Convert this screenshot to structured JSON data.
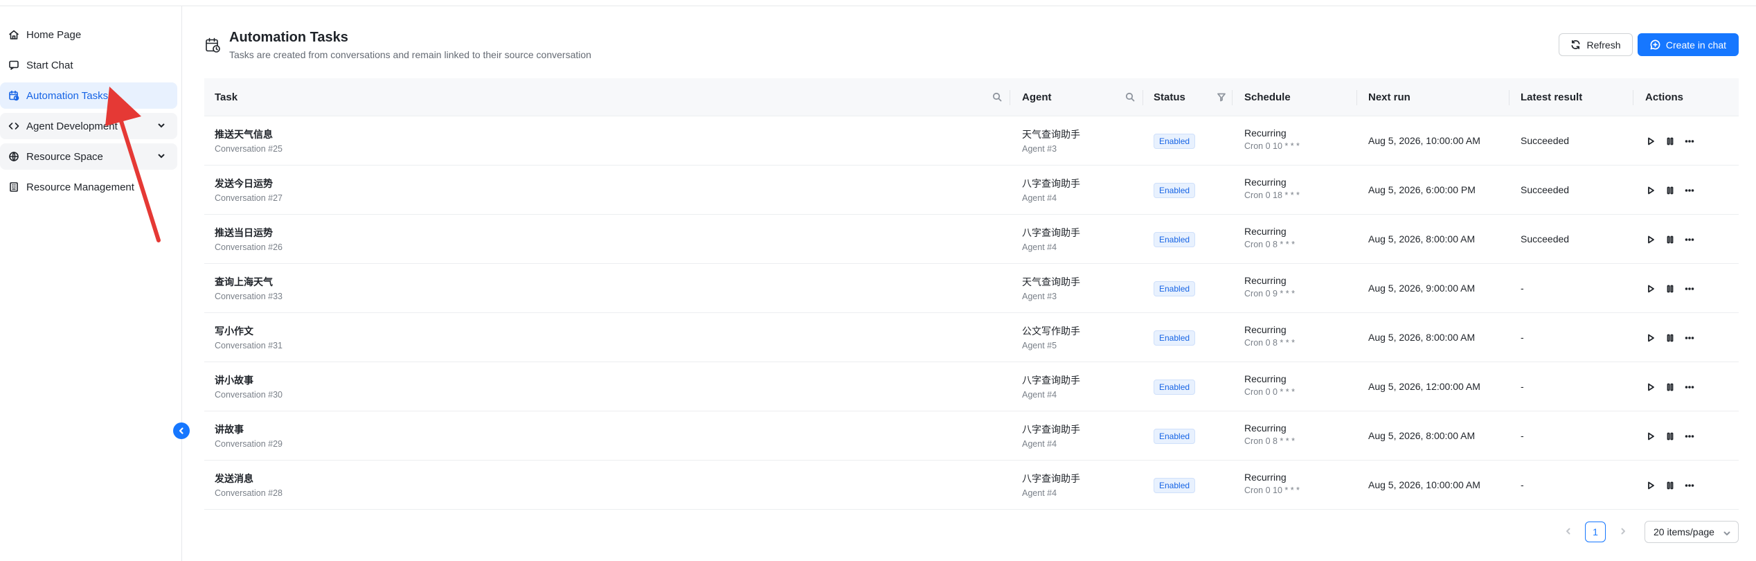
{
  "sidebar": {
    "items": [
      {
        "label": "Home Page",
        "icon": "home-icon"
      },
      {
        "label": "Start Chat",
        "icon": "chat-icon"
      },
      {
        "label": "Automation Tasks",
        "icon": "calendar-clock-icon",
        "active": true
      },
      {
        "label": "Agent Development",
        "icon": "code-icon",
        "expandable": true
      },
      {
        "label": "Resource Space",
        "icon": "globe-icon",
        "expandable": true
      },
      {
        "label": "Resource Management",
        "icon": "building-icon"
      }
    ]
  },
  "header": {
    "title": "Automation Tasks",
    "subtitle": "Tasks are created from conversations and remain linked to their source conversation",
    "refresh_label": "Refresh",
    "create_label": "Create in chat"
  },
  "table": {
    "columns": {
      "task": "Task",
      "agent": "Agent",
      "status": "Status",
      "schedule": "Schedule",
      "next_run": "Next run",
      "latest_result": "Latest result",
      "actions": "Actions"
    },
    "rows": [
      {
        "task": "推送天气信息",
        "conversation": "Conversation #25",
        "agent": "天气查询助手",
        "agent_id": "Agent #3",
        "status": "Enabled",
        "schedule": "Recurring",
        "cron": "Cron 0 10 * * *",
        "next_run": "Aug 5, 2026, 10:00:00 AM",
        "result": "Succeeded"
      },
      {
        "task": "发送今日运势",
        "conversation": "Conversation #27",
        "agent": "八字查询助手",
        "agent_id": "Agent #4",
        "status": "Enabled",
        "schedule": "Recurring",
        "cron": "Cron 0 18 * * *",
        "next_run": "Aug 5, 2026, 6:00:00 PM",
        "result": "Succeeded"
      },
      {
        "task": "推送当日运势",
        "conversation": "Conversation #26",
        "agent": "八字查询助手",
        "agent_id": "Agent #4",
        "status": "Enabled",
        "schedule": "Recurring",
        "cron": "Cron 0 8 * * *",
        "next_run": "Aug 5, 2026, 8:00:00 AM",
        "result": "Succeeded"
      },
      {
        "task": "查询上海天气",
        "conversation": "Conversation #33",
        "agent": "天气查询助手",
        "agent_id": "Agent #3",
        "status": "Enabled",
        "schedule": "Recurring",
        "cron": "Cron 0 9 * * *",
        "next_run": "Aug 5, 2026, 9:00:00 AM",
        "result": "-"
      },
      {
        "task": "写小作文",
        "conversation": "Conversation #31",
        "agent": "公文写作助手",
        "agent_id": "Agent #5",
        "status": "Enabled",
        "schedule": "Recurring",
        "cron": "Cron 0 8 * * *",
        "next_run": "Aug 5, 2026, 8:00:00 AM",
        "result": "-"
      },
      {
        "task": "讲小故事",
        "conversation": "Conversation #30",
        "agent": "八字查询助手",
        "agent_id": "Agent #4",
        "status": "Enabled",
        "schedule": "Recurring",
        "cron": "Cron 0 0 * * *",
        "next_run": "Aug 5, 2026, 12:00:00 AM",
        "result": "-"
      },
      {
        "task": "讲故事",
        "conversation": "Conversation #29",
        "agent": "八字查询助手",
        "agent_id": "Agent #4",
        "status": "Enabled",
        "schedule": "Recurring",
        "cron": "Cron 0 8 * * *",
        "next_run": "Aug 5, 2026, 8:00:00 AM",
        "result": "-"
      },
      {
        "task": "发送消息",
        "conversation": "Conversation #28",
        "agent": "八字查询助手",
        "agent_id": "Agent #4",
        "status": "Enabled",
        "schedule": "Recurring",
        "cron": "Cron 0 10 * * *",
        "next_run": "Aug 5, 2026, 10:00:00 AM",
        "result": "-"
      }
    ]
  },
  "pagination": {
    "current_page": "1",
    "page_size": "20 items/page"
  },
  "colors": {
    "accent": "#1677ff",
    "active_bg": "#e8f1fe",
    "annotation": "#e53935"
  }
}
